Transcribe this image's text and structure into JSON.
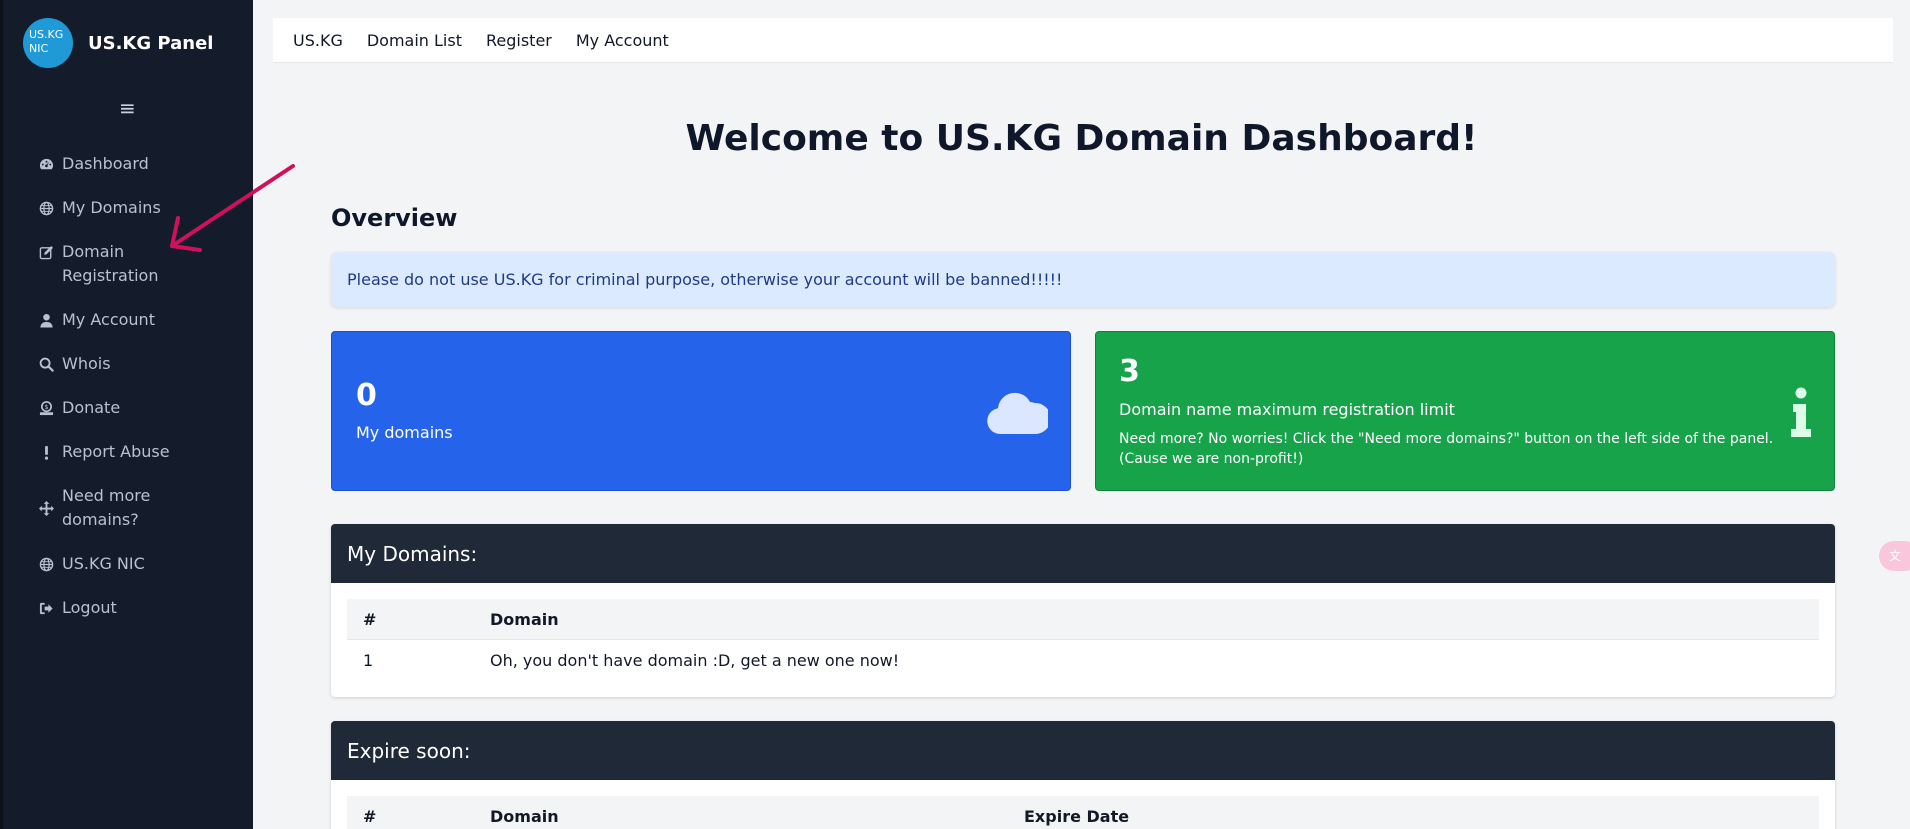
{
  "sidebar": {
    "logo_text": "US.KG\nNIC",
    "title": "US.KG Panel",
    "menu_icon": "hamburger-icon",
    "items": [
      {
        "label": "Dashboard",
        "icon": "gauge-icon"
      },
      {
        "label": "My Domains",
        "icon": "globe-icon"
      },
      {
        "label": "Domain\nRegistration",
        "icon": "edit-icon"
      },
      {
        "label": "My Account",
        "icon": "user-icon"
      },
      {
        "label": "Whois",
        "icon": "search-icon"
      },
      {
        "label": "Donate",
        "icon": "donate-icon"
      },
      {
        "label": "Report Abuse",
        "icon": "exclamation-icon"
      },
      {
        "label": "Need more\ndomains?",
        "icon": "move-icon"
      },
      {
        "label": "US.KG NIC",
        "icon": "globe-icon"
      },
      {
        "label": "Logout",
        "icon": "logout-icon"
      }
    ]
  },
  "topnav": {
    "links": [
      "US.KG",
      "Domain List",
      "Register",
      "My Account"
    ]
  },
  "main": {
    "title": "Welcome to US.KG Domain Dashboard!",
    "overview_heading": "Overview",
    "alert": "Please do not use US.KG for criminal purpose, otherwise your account will be banned!!!!!",
    "card_domains": {
      "count": "0",
      "label": "My domains",
      "icon": "cloud-icon"
    },
    "card_limit": {
      "count": "3",
      "label": "Domain name maximum registration limit",
      "note": "Need more? No worries! Click the \"Need more domains?\" button on the left side of the panel. (Cause we are non-profit!)",
      "icon": "info-icon"
    },
    "my_domains_panel": {
      "title": "My Domains:",
      "headers": [
        "#",
        "Domain"
      ],
      "rows": [
        [
          "1",
          "Oh, you don't have domain :D, get a new one now!"
        ]
      ]
    },
    "expire_panel": {
      "title": "Expire soon:",
      "headers": [
        "#",
        "Domain",
        "Expire Date"
      ]
    }
  },
  "colors": {
    "sidebar_bg": "#141b2b",
    "blue_card": "#2563eb",
    "green_card": "#16a34a",
    "panel_header": "#1f2937",
    "alert_bg": "#dbeafe",
    "annotation_arrow": "#d0105a"
  }
}
